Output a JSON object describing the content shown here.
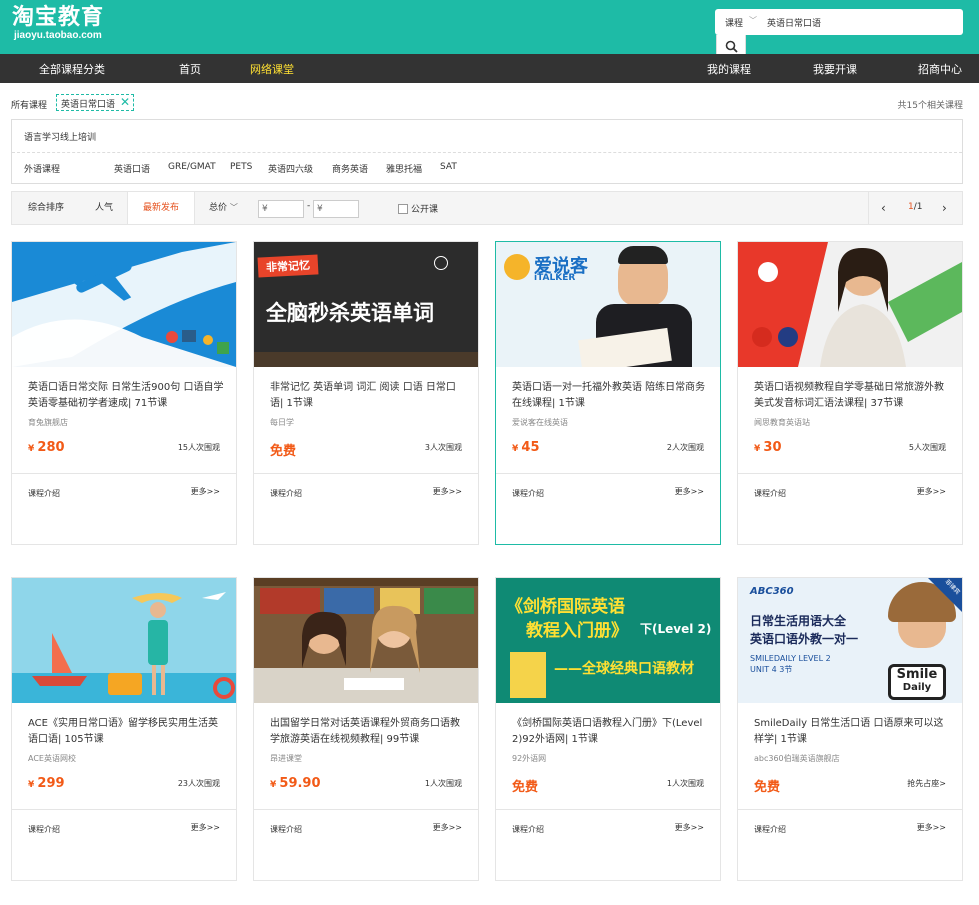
{
  "header": {
    "logo_main": "淘宝教育",
    "logo_sub": "jiaoyu.taobao.com",
    "search_type": "课程",
    "search_value": "英语日常口语"
  },
  "nav": {
    "left": [
      "全部课程分类",
      "首页",
      "网络课堂"
    ],
    "right": [
      "我的课程",
      "我要开课",
      "招商中心"
    ]
  },
  "breadcrumb": {
    "label": "所有课程",
    "tag": "英语日常口语",
    "total": "共15个相关课程"
  },
  "filters": {
    "category1": "语言学习线上培训",
    "category2": "外语课程",
    "options": [
      "英语口语",
      "GRE/GMAT",
      "PETS",
      "英语四六级",
      "商务英语",
      "雅思托福",
      "SAT"
    ]
  },
  "sortbar": {
    "items": [
      "综合排序",
      "人气",
      "最新发布",
      "总价"
    ],
    "price_placeholder": "¥",
    "price_sep": "-",
    "public_label": "公开课",
    "page_current": "1",
    "page_total": "/1"
  },
  "cards": [
    {
      "title": "英语口语日常交际 日常生活900句 口语自学英语零基础初学者速成| 71节课",
      "shop": "育兔旗舰店",
      "price": "280",
      "free": false,
      "views": "15人次围观",
      "intro": "课程介绍",
      "more": "更多>>"
    },
    {
      "title": "非常记忆 英语单词 词汇 阅读 口语 日常口语| 1节课",
      "shop": "每日学",
      "price": "免费",
      "free": true,
      "views": "3人次围观",
      "intro": "课程介绍",
      "more": "更多>>",
      "thumb_title": "全脑秒杀英语单词",
      "thumb_badge": "非常记忆"
    },
    {
      "title": "英语口语一对一托福外教英语 陪练日常商务 在线课程| 1节课",
      "shop": "爱说客在线英语",
      "price": "45",
      "free": false,
      "views": "2人次围观",
      "intro": "课程介绍",
      "more": "更多>>",
      "thumb_brand": "爱说客",
      "thumb_brand_en": "iTALKER"
    },
    {
      "title": "英语口语视频教程自学零基础日常旅游外教美式发音标词汇语法课程| 37节课",
      "shop": "闻思教育英语站",
      "price": "30",
      "free": false,
      "views": "5人次围观",
      "intro": "课程介绍",
      "more": "更多>>"
    },
    {
      "title": "ACE《实用日常口语》留学移民实用生活英语口语| 105节课",
      "shop": "ACE英语网校",
      "price": "299",
      "free": false,
      "views": "23人次围观",
      "intro": "课程介绍",
      "more": "更多>>"
    },
    {
      "title": "出国留学日常对话英语课程外贸商务口语教学旅游英语在线视频教程| 99节课",
      "shop": "昂进课堂",
      "price": "59.90",
      "free": false,
      "views": "1人次围观",
      "intro": "课程介绍",
      "more": "更多>>"
    },
    {
      "title": "《剑桥国际英语口语教程入门册》下(Level 2)92外语网| 1节课",
      "shop": "92外语网",
      "price": "免费",
      "free": true,
      "views": "1人次围观",
      "intro": "课程介绍",
      "more": "更多>>",
      "thumb_line1": "《剑桥国际英语",
      "thumb_line2": "教程入门册》",
      "thumb_level": "下(Level 2)",
      "thumb_line3": "——全球经典口语教材"
    },
    {
      "title": "SmileDaily 日常生活口语 口语原来可以这样学| 1节课",
      "shop": "abc360伯瑞英语旗舰店",
      "price": "免费",
      "free": true,
      "views": "抢先占座>",
      "intro": "课程介绍",
      "more": "更多>>",
      "thumb_brand": "ABC360",
      "thumb_line1": "日常生活用语大全",
      "thumb_line2": "英语口语外教一对一",
      "thumb_line3": "SMILEDAILY LEVEL 2",
      "thumb_line4": "UNIT 4  3节",
      "thumb_corner": "菲律宾",
      "thumb_logo1": "Smile",
      "thumb_logo2": "Daily"
    }
  ],
  "colors": {
    "teal": "#1ebba6",
    "nav": "#333333",
    "price": "#f25a17",
    "active_nav": "#ffe033"
  }
}
